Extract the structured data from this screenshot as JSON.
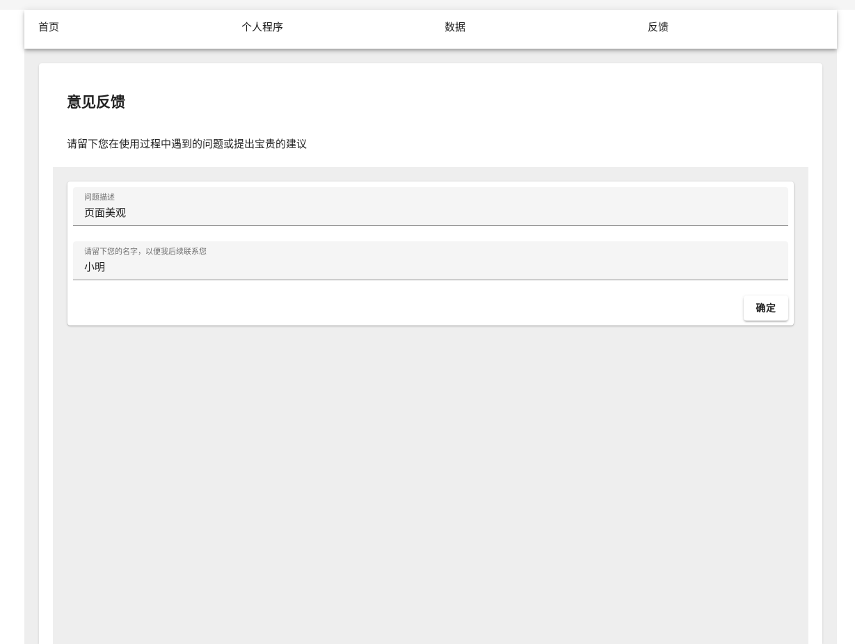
{
  "nav": {
    "items": [
      {
        "label": "首页"
      },
      {
        "label": "个人程序"
      },
      {
        "label": "数据"
      },
      {
        "label": "反馈"
      }
    ]
  },
  "page": {
    "title": "意见反馈",
    "subtitle": "请留下您在使用过程中遇到的问题或提出宝贵的建议"
  },
  "form": {
    "fields": [
      {
        "label": "问题描述",
        "value": "页面美观"
      },
      {
        "label": "请留下您的名字，以便我后续联系您",
        "value": "小明"
      }
    ],
    "submit_label": "确定"
  }
}
